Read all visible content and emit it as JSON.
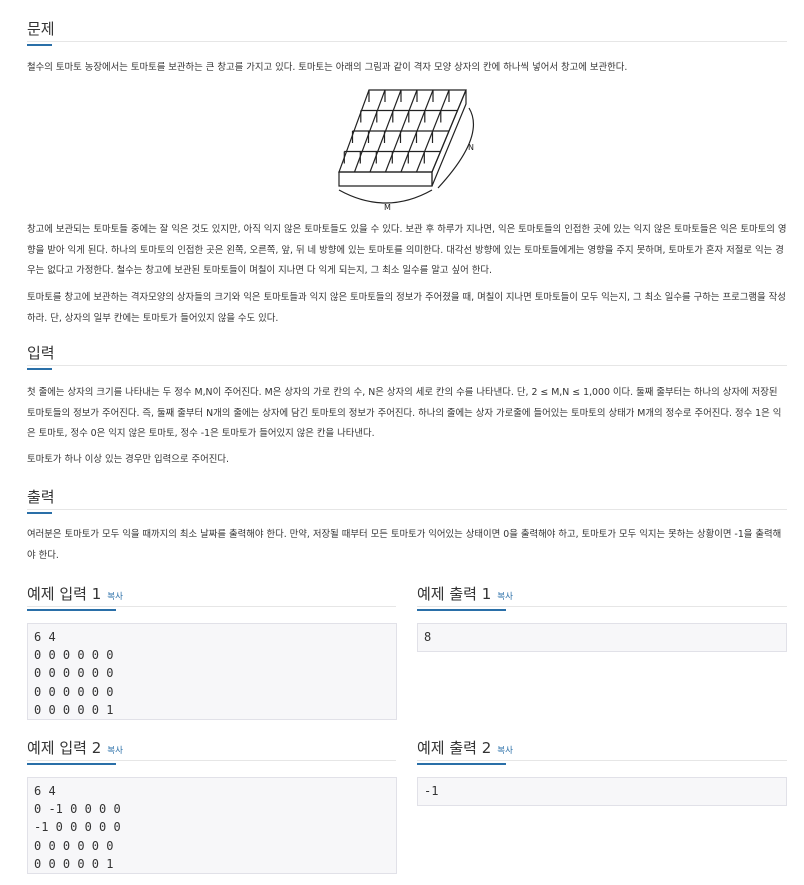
{
  "sections": {
    "problem": {
      "title": "문제"
    },
    "input": {
      "title": "입력"
    },
    "output": {
      "title": "출력"
    }
  },
  "problem": {
    "intro": "철수의 토마토 농장에서는 토마토를 보관하는 큰 창고를 가지고 있다. 토마토는 아래의 그림과 같이 격자 모양 상자의 칸에 하나씩 넣어서 창고에 보관한다.",
    "figure": {
      "label_n": "N",
      "label_m": "M"
    },
    "p2": "창고에 보관되는 토마토들 중에는 잘 익은 것도 있지만, 아직 익지 않은 토마토들도 있을 수 있다. 보관 후 하루가 지나면, 익은 토마토들의 인접한 곳에 있는 익지 않은 토마토들은 익은 토마토의 영향을 받아 익게 된다. 하나의 토마토의 인접한 곳은 왼쪽, 오른쪽, 앞, 뒤 네 방향에 있는 토마토를 의미한다. 대각선 방향에 있는 토마토들에게는 영향을 주지 못하며, 토마토가 혼자 저절로 익는 경우는 없다고 가정한다. 철수는 창고에 보관된 토마토들이 며칠이 지나면 다 익게 되는지, 그 최소 일수를 알고 싶어 한다.",
    "p3": "토마토를 창고에 보관하는 격자모양의 상자들의 크기와 익은 토마토들과 익지 않은 토마토들의 정보가 주어졌을 때, 며칠이 지나면 토마토들이 모두 익는지, 그 최소 일수를 구하는 프로그램을 작성하라. 단, 상자의 일부 칸에는 토마토가 들어있지 않을 수도 있다."
  },
  "input": {
    "p1": "첫 줄에는 상자의 크기를 나타내는 두 정수 M,N이 주어진다. M은 상자의 가로 칸의 수, N은 상자의 세로 칸의 수를 나타낸다. 단, 2 ≤ M,N ≤ 1,000 이다. 둘째 줄부터는 하나의 상자에 저장된 토마토들의 정보가 주어진다. 즉, 둘째 줄부터 N개의 줄에는 상자에 담긴 토마토의 정보가 주어진다. 하나의 줄에는 상자 가로줄에 들어있는 토마토의 상태가 M개의 정수로 주어진다. 정수 1은 익은 토마토, 정수 0은 익지 않은 토마토, 정수 -1은 토마토가 들어있지 않은 칸을 나타낸다.",
    "p2": "토마토가 하나 이상 있는 경우만 입력으로 주어진다."
  },
  "output": {
    "p1": "여러분은 토마토가 모두 익을 때까지의 최소 날짜를 출력해야 한다. 만약, 저장될 때부터 모든 토마토가 익어있는 상태이면 0을 출력해야 하고, 토마토가 모두 익지는 못하는 상황이면 -1을 출력해야 한다."
  },
  "samples": {
    "copy_label": "복사",
    "in1": {
      "title": "예제 입력 1",
      "text": "6 4\n0 0 0 0 0 0\n0 0 0 0 0 0\n0 0 0 0 0 0\n0 0 0 0 0 1"
    },
    "out1": {
      "title": "예제 출력 1",
      "text": "8"
    },
    "in2": {
      "title": "예제 입력 2",
      "text": "6 4\n0 -1 0 0 0 0\n-1 0 0 0 0 0\n0 0 0 0 0 0\n0 0 0 0 0 1"
    },
    "out2": {
      "title": "예제 출력 2",
      "text": "-1"
    }
  }
}
